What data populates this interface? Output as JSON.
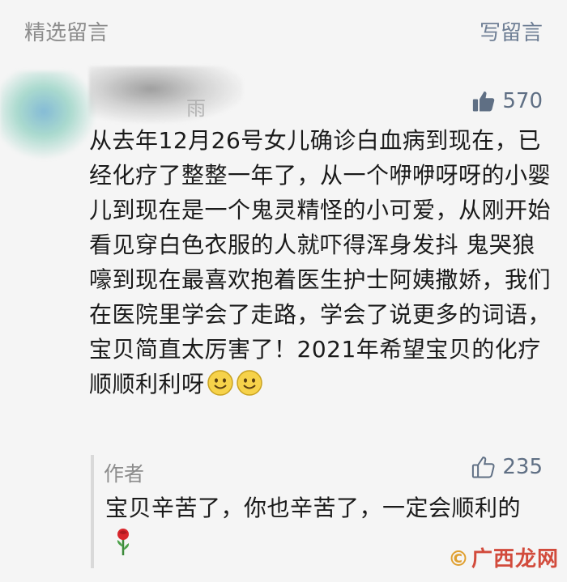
{
  "header": {
    "section_title": "精选留言",
    "write_label": "写留言"
  },
  "comment": {
    "author_partial": "雨",
    "likes": "570",
    "text": "从去年12月26号女儿确诊白血病到现在，已经化疗了整整一年了，从一个咿咿呀呀的小婴儿到现在是一个鬼灵精怪的小可爱，从刚开始看见穿白色衣服的人就吓得浑身发抖 鬼哭狼嚎到现在最喜欢抱着医生护士阿姨撒娇，我们在医院里学会了走路，学会了说更多的词语，宝贝简直太厉害了！2021年希望宝贝的化疗顺顺利利呀"
  },
  "reply": {
    "author": "作者",
    "likes": "235",
    "text": "宝贝辛苦了，你也辛苦了，一定会顺利的"
  },
  "watermark": {
    "text": "广西龙网"
  },
  "icons": {
    "like_main": "thumbs-up-filled-icon",
    "like_reply": "thumbs-up-outline-icon",
    "emoji": "smiley-face-icon",
    "rose": "rose-icon"
  },
  "colors": {
    "link": "#6f7f95",
    "muted": "#8c8c8c",
    "watermark": "#d24b3c"
  }
}
